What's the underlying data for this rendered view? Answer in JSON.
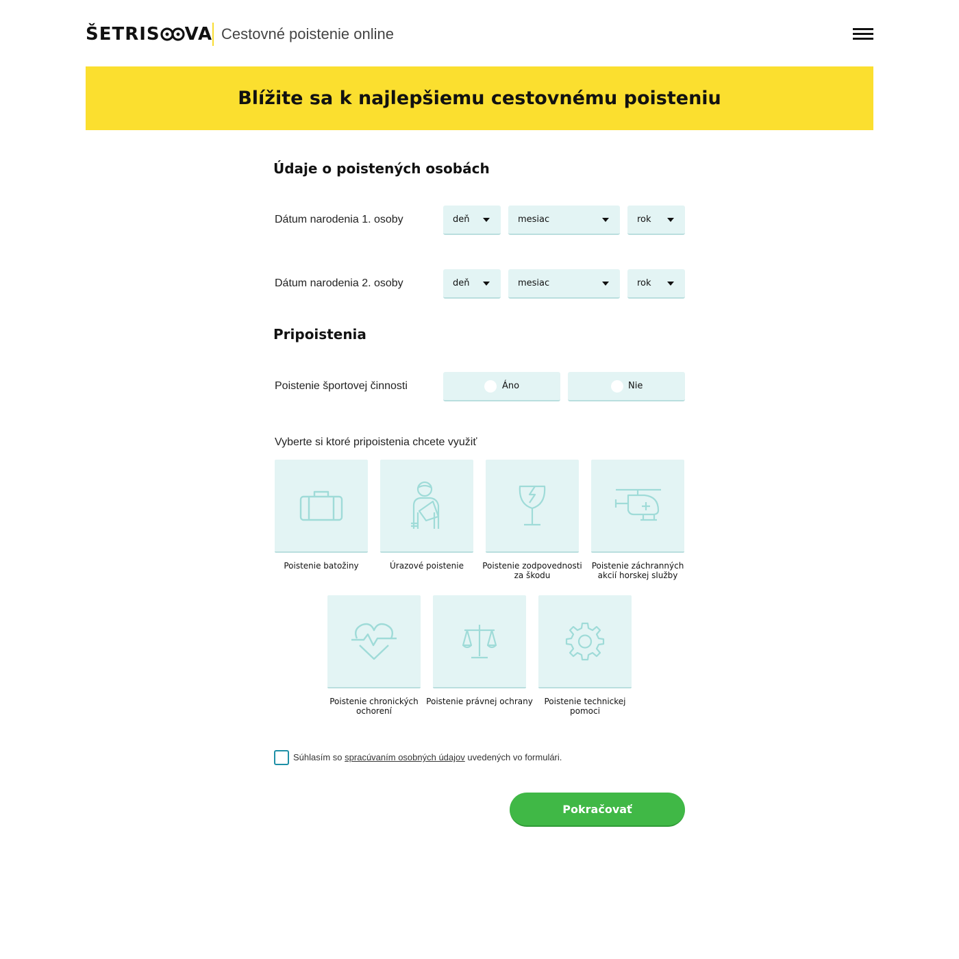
{
  "header": {
    "logo_text": "ŠETRISOVA",
    "logo_left": "ŠETRIS",
    "logo_right": "VA",
    "tagline": "Cestovné poistenie online",
    "menu_icon": "hamburger-menu-icon"
  },
  "banner": {
    "title": "Blížite sa k najlepšiemu cestovnému poisteniu"
  },
  "persons": {
    "title": "Údaje o poistených osobách",
    "rows": [
      {
        "label": "Dátum narodenia 1. osoby",
        "day": "deň",
        "month": "mesiac",
        "year": "rok"
      },
      {
        "label": "Dátum narodenia 2. osoby",
        "day": "deň",
        "month": "mesiac",
        "year": "rok"
      }
    ]
  },
  "addons": {
    "title": "Pripoistenia",
    "sport_label": "Poistenie športovej činnosti",
    "yes": "Áno",
    "no": "Nie",
    "choose_label": "Vyberte si ktoré pripoistenia chcete využiť",
    "cards": [
      {
        "label": "Poistenie batožiny",
        "icon": "suitcase-icon"
      },
      {
        "label": "Úrazové poistenie",
        "icon": "injured-person-icon"
      },
      {
        "label": "Poistenie zodpovednosti za škodu",
        "icon": "broken-glass-icon"
      },
      {
        "label": "Poistenie záchranných akcií horskej služby",
        "icon": "rescue-helicopter-icon"
      },
      {
        "label": "Poistenie chronických ochorení",
        "icon": "heartbeat-icon"
      },
      {
        "label": "Poistenie právnej ochrany",
        "icon": "scales-icon"
      },
      {
        "label": "Poistenie technickej pomoci",
        "icon": "gear-icon"
      }
    ]
  },
  "consent": {
    "before": "Súhlasím so ",
    "link": "spracúvaním osobných údajov",
    "after": " uvedených vo formulári."
  },
  "continue_label": "Pokračovať",
  "colors": {
    "accent_yellow": "#fbdf2f",
    "tile_bg": "#e3f4f4",
    "icon_stroke": "#9fdbd8",
    "button_green": "#40b846",
    "checkbox_border": "#1d8fa6"
  }
}
